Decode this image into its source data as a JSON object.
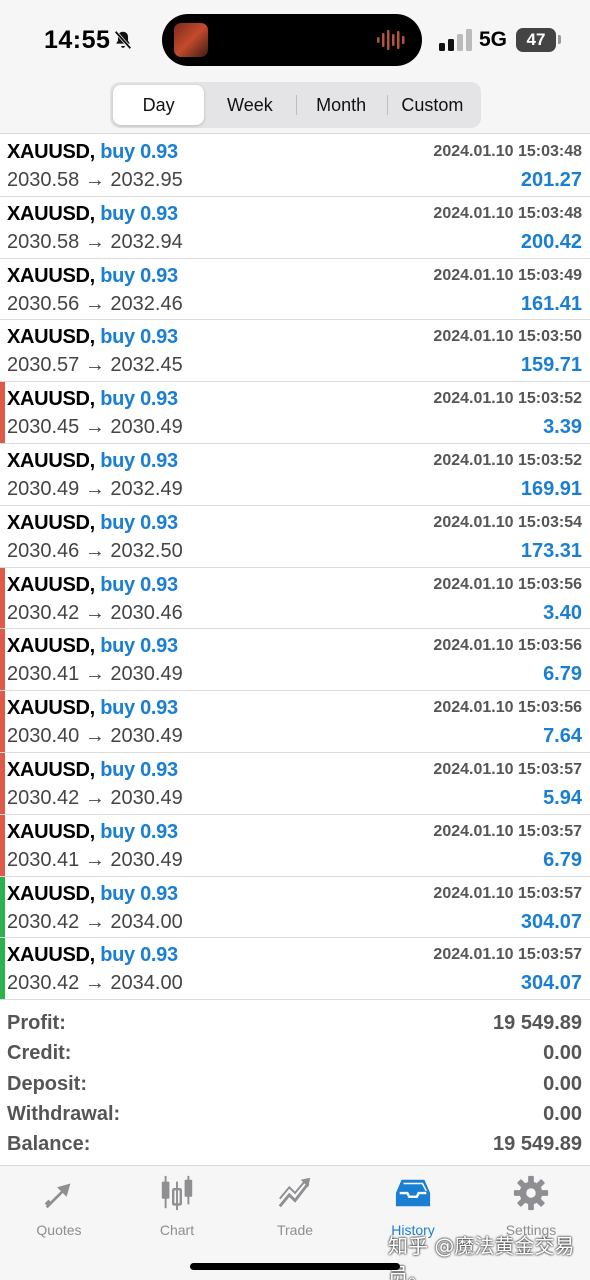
{
  "status_bar": {
    "time": "14:55",
    "network": "5G",
    "battery": "47"
  },
  "period_tabs": [
    {
      "label": "Day",
      "active": true
    },
    {
      "label": "Week",
      "active": false
    },
    {
      "label": "Month",
      "active": false
    },
    {
      "label": "Custom",
      "active": false
    }
  ],
  "colors": {
    "accent": "#1a7fd3",
    "loss_marker": "#e05a47",
    "profit_marker": "#2bb24c"
  },
  "trades": [
    {
      "symbol": "XAUUSD,",
      "side": "buy 0.93",
      "open": "2030.58",
      "close": "2032.95",
      "arrow": "→",
      "time": "2024.01.10 15:03:48",
      "profit": "201.27",
      "marker": "none"
    },
    {
      "symbol": "XAUUSD,",
      "side": "buy 0.93",
      "open": "2030.58",
      "close": "2032.94",
      "arrow": "→",
      "time": "2024.01.10 15:03:48",
      "profit": "200.42",
      "marker": "none"
    },
    {
      "symbol": "XAUUSD,",
      "side": "buy 0.93",
      "open": "2030.56",
      "close": "2032.46",
      "arrow": "→",
      "time": "2024.01.10 15:03:49",
      "profit": "161.41",
      "marker": "none"
    },
    {
      "symbol": "XAUUSD,",
      "side": "buy 0.93",
      "open": "2030.57",
      "close": "2032.45",
      "arrow": "→",
      "time": "2024.01.10 15:03:50",
      "profit": "159.71",
      "marker": "none"
    },
    {
      "symbol": "XAUUSD,",
      "side": "buy 0.93",
      "open": "2030.45",
      "close": "2030.49",
      "arrow": "→",
      "time": "2024.01.10 15:03:52",
      "profit": "3.39",
      "marker": "red"
    },
    {
      "symbol": "XAUUSD,",
      "side": "buy 0.93",
      "open": "2030.49",
      "close": "2032.49",
      "arrow": "→",
      "time": "2024.01.10 15:03:52",
      "profit": "169.91",
      "marker": "none"
    },
    {
      "symbol": "XAUUSD,",
      "side": "buy 0.93",
      "open": "2030.46",
      "close": "2032.50",
      "arrow": "→",
      "time": "2024.01.10 15:03:54",
      "profit": "173.31",
      "marker": "none"
    },
    {
      "symbol": "XAUUSD,",
      "side": "buy 0.93",
      "open": "2030.42",
      "close": "2030.46",
      "arrow": "→",
      "time": "2024.01.10 15:03:56",
      "profit": "3.40",
      "marker": "red"
    },
    {
      "symbol": "XAUUSD,",
      "side": "buy 0.93",
      "open": "2030.41",
      "close": "2030.49",
      "arrow": "→",
      "time": "2024.01.10 15:03:56",
      "profit": "6.79",
      "marker": "red"
    },
    {
      "symbol": "XAUUSD,",
      "side": "buy 0.93",
      "open": "2030.40",
      "close": "2030.49",
      "arrow": "→",
      "time": "2024.01.10 15:03:56",
      "profit": "7.64",
      "marker": "red"
    },
    {
      "symbol": "XAUUSD,",
      "side": "buy 0.93",
      "open": "2030.42",
      "close": "2030.49",
      "arrow": "→",
      "time": "2024.01.10 15:03:57",
      "profit": "5.94",
      "marker": "red"
    },
    {
      "symbol": "XAUUSD,",
      "side": "buy 0.93",
      "open": "2030.41",
      "close": "2030.49",
      "arrow": "→",
      "time": "2024.01.10 15:03:57",
      "profit": "6.79",
      "marker": "red"
    },
    {
      "symbol": "XAUUSD,",
      "side": "buy 0.93",
      "open": "2030.42",
      "close": "2034.00",
      "arrow": "→",
      "time": "2024.01.10 15:03:57",
      "profit": "304.07",
      "marker": "green"
    },
    {
      "symbol": "XAUUSD,",
      "side": "buy 0.93",
      "open": "2030.42",
      "close": "2034.00",
      "arrow": "→",
      "time": "2024.01.10 15:03:57",
      "profit": "304.07",
      "marker": "green"
    }
  ],
  "summary": [
    {
      "label": "Profit:",
      "value": "19 549.89"
    },
    {
      "label": "Credit:",
      "value": "0.00"
    },
    {
      "label": "Deposit:",
      "value": "0.00"
    },
    {
      "label": "Withdrawal:",
      "value": "0.00"
    },
    {
      "label": "Balance:",
      "value": "19 549.89"
    }
  ],
  "tabbar": [
    {
      "label": "Quotes",
      "icon": "quotes-arrows-icon",
      "active": false
    },
    {
      "label": "Chart",
      "icon": "candlestick-chart-icon",
      "active": false
    },
    {
      "label": "Trade",
      "icon": "trade-trend-icon",
      "active": false
    },
    {
      "label": "History",
      "icon": "history-inbox-icon",
      "active": true
    },
    {
      "label": "Settings",
      "icon": "gear-icon",
      "active": false
    }
  ],
  "watermark": "知乎 @魔法黄金交易员。"
}
